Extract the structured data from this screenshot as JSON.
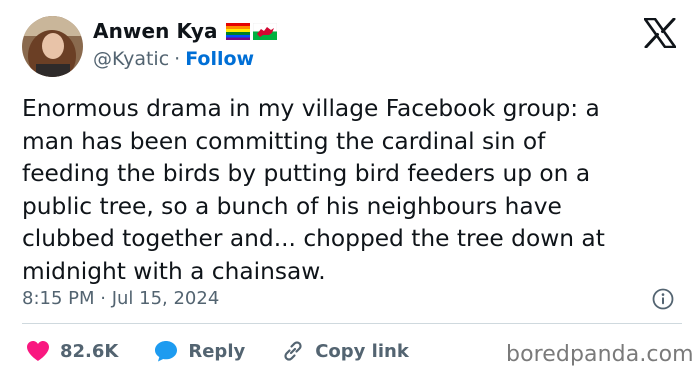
{
  "author": {
    "display_name": "Anwen Kya",
    "handle": "@Kyatic",
    "separator": "·",
    "follow_label": "Follow",
    "flags": [
      "rainbow-flag-icon",
      "wales-flag-icon"
    ]
  },
  "tweet": {
    "text": "Enormous drama in my village Facebook group: a\nman has been committing the cardinal sin of\nfeeding the birds by putting bird feeders up on a\npublic tree, so a bunch of his neighbours have\nclubbed together and... chopped the tree down at\nmidnight with a chainsaw.",
    "timestamp": "8:15 PM · Jul 15, 2024"
  },
  "actions": {
    "like_count": "82.6K",
    "reply_label": "Reply",
    "copy_link_label": "Copy link"
  },
  "watermark": "boredpanda.com",
  "colors": {
    "text": "#0f1419",
    "secondary": "#536471",
    "link": "#006fd6",
    "like": "#f91880",
    "reply": "#1d9bf0"
  }
}
